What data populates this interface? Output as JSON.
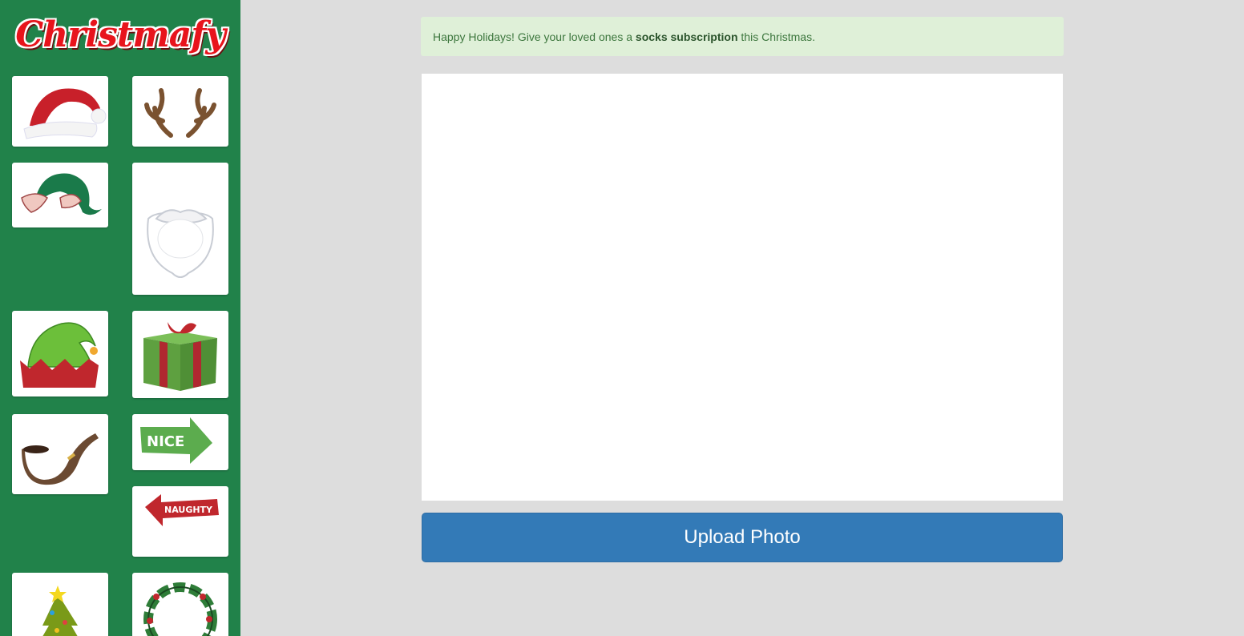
{
  "app": {
    "logo_text": "Christmafy"
  },
  "notice": {
    "prefix": "Happy Holidays! Give your loved ones a ",
    "highlight": "socks subscription",
    "suffix": " this Christmas."
  },
  "upload_button": {
    "label": "Upload Photo"
  },
  "stickers": [
    {
      "name": "santa-hat-icon"
    },
    {
      "name": "reindeer-antlers-icon"
    },
    {
      "name": "elf-ears-hat-icon"
    },
    {
      "name": "santa-beard-icon"
    },
    {
      "name": "elf-hat-icon"
    },
    {
      "name": "gift-box-icon"
    },
    {
      "name": "pipe-icon"
    },
    {
      "name": "nice-sign-icon",
      "text": "NICE"
    },
    {
      "name": "naughty-sign-icon",
      "text": "NAUGHTY"
    },
    {
      "name": "christmas-tree-icon"
    },
    {
      "name": "wreath-icon"
    }
  ],
  "colors": {
    "sidebar": "#21824a",
    "notice_bg": "#dff0d8",
    "notice_text": "#3c763d",
    "button": "#337ab7",
    "logo": "#e8141c"
  }
}
